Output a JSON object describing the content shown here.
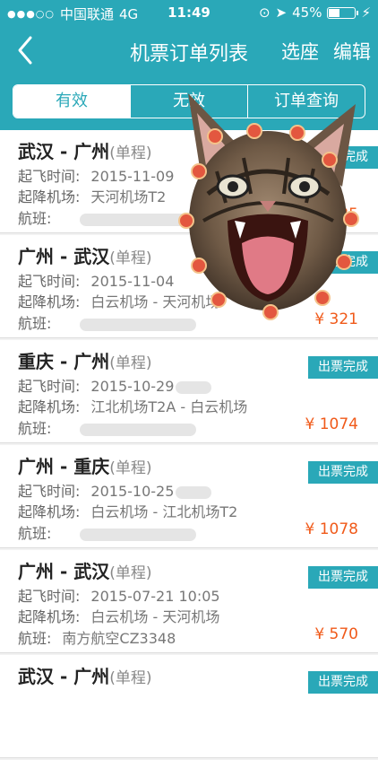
{
  "status_bar": {
    "carrier": "中国联通",
    "network": "4G",
    "time": "11:49",
    "battery": "45%"
  },
  "nav": {
    "title": "机票订单列表",
    "select_label": "选座",
    "edit_label": "编辑"
  },
  "tabs": [
    {
      "label": "有效",
      "active": true
    },
    {
      "label": "无效"
    },
    {
      "label": "订单查询"
    }
  ],
  "labels": {
    "depart_time": "起飞时间:",
    "airports": "起降机场:",
    "flight": "航班:"
  },
  "orders": [
    {
      "route": "武汉 - 广州",
      "kind": "(单程)",
      "time": "2015-11-09",
      "airports": "天河机场T2",
      "flight": "",
      "status": "出票完成",
      "price": "¥ 535"
    },
    {
      "route": "广州 - 武汉",
      "kind": "(单程)",
      "time": "2015-11-04",
      "airports": "白云机场 - 天河机场",
      "flight": "",
      "status": "出票完成",
      "price": "¥ 321"
    },
    {
      "route": "重庆 - 广州",
      "kind": "(单程)",
      "time": "2015-10-29",
      "airports": "江北机场T2A - 白云机场",
      "flight": "",
      "status": "出票完成",
      "price": "¥ 1074"
    },
    {
      "route": "广州 - 重庆",
      "kind": "(单程)",
      "time": "2015-10-25",
      "airports": "白云机场 - 江北机场T2",
      "flight": "",
      "status": "出票完成",
      "price": "¥ 1078"
    },
    {
      "route": "广州 - 武汉",
      "kind": "(单程)",
      "time": "2015-07-21 10:05",
      "airports": "白云机场 - 天河机场",
      "flight": "南方航空CZ3348",
      "status": "出票完成",
      "price": "¥ 570"
    },
    {
      "route": "武汉 - 广州",
      "kind": "(单程)",
      "time": "",
      "airports": "",
      "flight": "",
      "status": "出票完成",
      "price": ""
    }
  ],
  "colors": {
    "brand": "#2aa8b8",
    "price": "#f05a1a"
  },
  "icons": {
    "back": "chevron-left-icon",
    "sticker": "screaming-cat-sticker"
  }
}
